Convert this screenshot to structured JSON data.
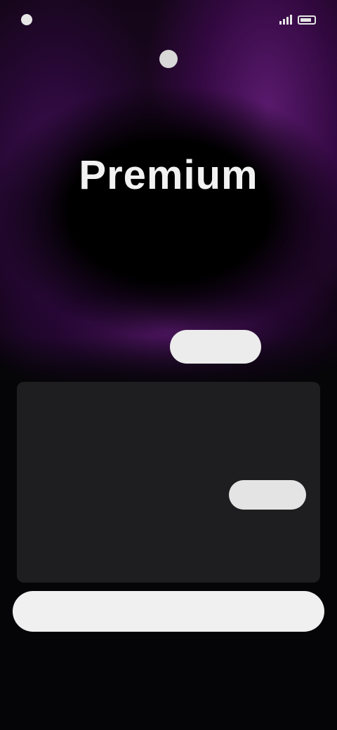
{
  "status_bar": {
    "time": "",
    "carrier": "",
    "battery": ""
  },
  "nav": {
    "left_label": "",
    "right_label": ""
  },
  "hero": {
    "title": "Premium",
    "subtitle": ""
  },
  "plan_tabs": [
    {
      "label": ""
    },
    {
      "label": ""
    },
    {
      "label": "",
      "active": true
    },
    {
      "label": ""
    }
  ],
  "card": {
    "row1_label": "",
    "row1_value": "",
    "row2_label": "",
    "row3_label": "",
    "select_label": "",
    "features": [
      "",
      "",
      "",
      ""
    ]
  },
  "primary_button": {
    "label": ""
  },
  "footer": {
    "link_label": ""
  },
  "colors": {
    "accent": "#5a1a6e",
    "card_bg": "#1e1e20",
    "button_bg": "#f0f0f0"
  }
}
